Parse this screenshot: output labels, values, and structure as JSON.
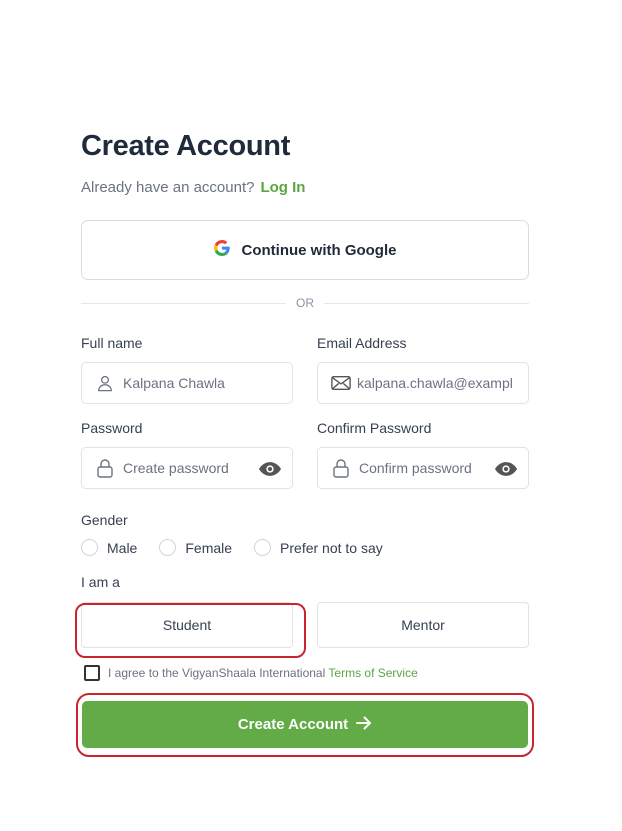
{
  "header": {
    "title": "Create Account",
    "subtitle": "Already have an account?",
    "login_link": "Log In"
  },
  "google": {
    "label": "Continue with Google",
    "icon": "google-g-icon"
  },
  "divider": {
    "text": "OR"
  },
  "fields": {
    "full_name": {
      "label": "Full name",
      "value": "Kalpana Chawla",
      "icon": "user-icon"
    },
    "email": {
      "label": "Email Address",
      "value": "kalpana.chawla@exampl",
      "icon": "mail-icon"
    },
    "password": {
      "label": "Password",
      "placeholder": "Create password",
      "icon": "lock-icon",
      "toggle_icon": "eye-icon"
    },
    "confirm_password": {
      "label": "Confirm Password",
      "placeholder": "Confirm password",
      "icon": "lock-icon",
      "toggle_icon": "eye-icon"
    }
  },
  "gender": {
    "label": "Gender",
    "options": [
      "Male",
      "Female",
      "Prefer not to say"
    ]
  },
  "role": {
    "label": "I am a",
    "options": [
      "Student",
      "Mentor"
    ],
    "highlighted": "Student"
  },
  "agreement": {
    "text": "I agree to the VigyanShaala International",
    "link": "Terms of Service",
    "checked": false
  },
  "submit": {
    "label": "Create Account",
    "icon": "arrow-right-icon"
  },
  "colors": {
    "accent_green": "#62ab47",
    "link_green": "#5ba541",
    "highlight_red": "#c8262f",
    "title": "#1f2a3a"
  }
}
